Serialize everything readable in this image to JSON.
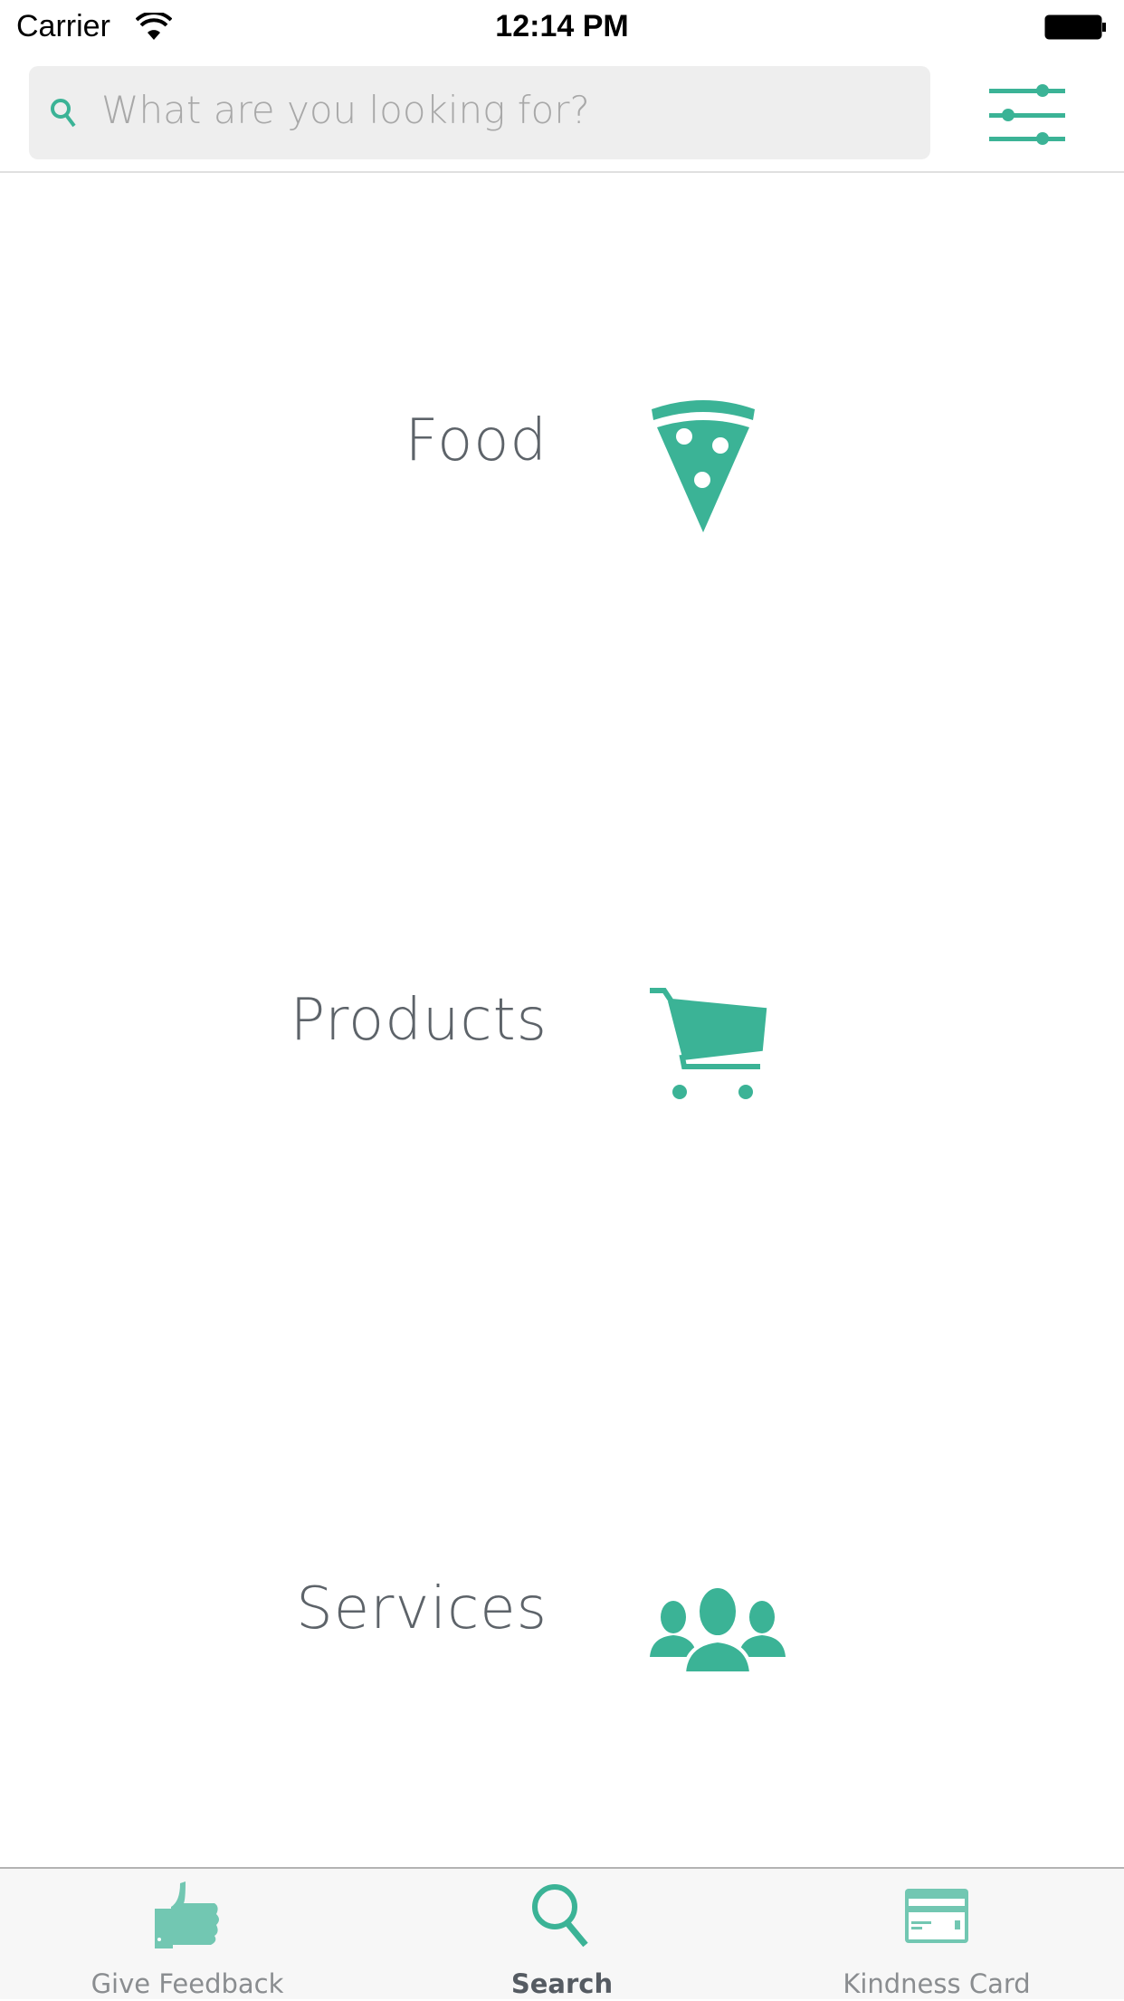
{
  "status_bar": {
    "carrier": "Carrier",
    "time": "12:14 PM"
  },
  "search": {
    "placeholder": "What are you looking for?",
    "icon": "search-icon"
  },
  "filter": {
    "icon": "sliders-icon"
  },
  "categories": [
    {
      "label": "Food",
      "icon": "pizza-icon"
    },
    {
      "label": "Products",
      "icon": "cart-icon"
    },
    {
      "label": "Services",
      "icon": "people-icon"
    }
  ],
  "tabs": [
    {
      "label": "Give Feedback",
      "icon": "thumbs-up-icon",
      "active": false
    },
    {
      "label": "Search",
      "icon": "search-icon",
      "active": true
    },
    {
      "label": "Kindness Card",
      "icon": "card-icon",
      "active": false
    }
  ],
  "colors": {
    "accent": "#3bb396",
    "accent_light": "#72c7b2",
    "text": "#5d6369"
  }
}
